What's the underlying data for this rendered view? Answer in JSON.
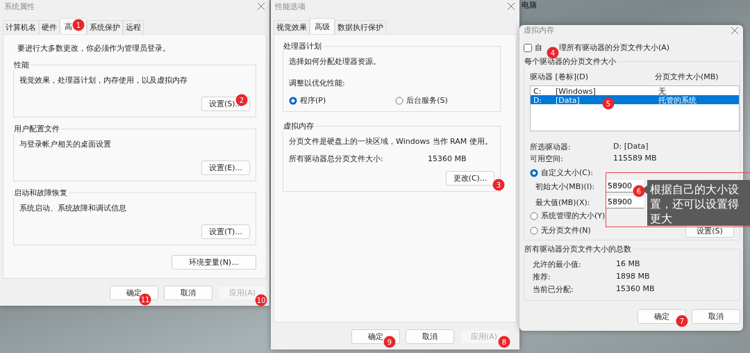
{
  "desktop": {
    "icon_label": "电脑"
  },
  "system_properties": {
    "title": "系统属性",
    "tabs": [
      {
        "label": "计算机名",
        "selected": false
      },
      {
        "label": "硬件",
        "selected": false
      },
      {
        "label": "高",
        "selected": true
      },
      {
        "label": "系统保护",
        "selected": false
      },
      {
        "label": "远程",
        "selected": false
      }
    ],
    "admin_note": "要进行大多数更改，你必须作为管理员登录。",
    "groups": [
      {
        "title": "性能",
        "description": "视觉效果，处理器计划，内存使用，以及虚拟内存",
        "button": "设置(S)..."
      },
      {
        "title": "用户配置文件",
        "description": "与登录帐户相关的桌面设置",
        "button": "设置(E)..."
      },
      {
        "title": "启动和故障恢复",
        "description": "系统启动、系统故障和调试信息",
        "button": "设置(T)..."
      }
    ],
    "env_button": "环境变量(N)...",
    "buttons": [
      {
        "label": "确定",
        "disabled": false
      },
      {
        "label": "取消",
        "disabled": false
      },
      {
        "label": "应用(A)",
        "disabled": true
      }
    ]
  },
  "performance_options": {
    "title": "性能选项",
    "tabs": [
      {
        "label": "视觉效果",
        "selected": false
      },
      {
        "label": "高级",
        "selected": true
      },
      {
        "label": "数据执行保护",
        "selected": false
      }
    ],
    "processor": {
      "title": "处理器计划",
      "description": "选择如何分配处理器资源。",
      "prompt": "调整以优化性能:",
      "options": [
        {
          "label": "程序(P)",
          "selected": true
        },
        {
          "label": "后台服务(S)",
          "selected": false
        }
      ]
    },
    "virtual_memory": {
      "title": "虚拟内存",
      "description": "分页文件是硬盘上的一块区域，Windows 当作 RAM 使用。",
      "total_label": "所有驱动器总分页文件大小:",
      "total_value": "15360 MB",
      "button": "更改(C)..."
    },
    "buttons": [
      {
        "label": "确定",
        "disabled": false
      },
      {
        "label": "取消",
        "disabled": false
      },
      {
        "label": "应用(A)",
        "disabled": true
      }
    ]
  },
  "virtual_memory": {
    "title": "虚拟内存",
    "auto_manage": {
      "label_start": "自",
      "label_end": "理所有驱动器的分页文件大小(A)",
      "checked": false
    },
    "per_drive": {
      "title": "每个驱动器的分页文件大小",
      "columns": [
        "驱动器 [卷标](D)",
        "分页文件大小(MB)"
      ],
      "drives": [
        {
          "drive": "C:",
          "volume": "[Windows]",
          "size": "无",
          "selected": false
        },
        {
          "drive": "D:",
          "volume": "[Data]",
          "size": "托管的系统",
          "selected": true
        }
      ],
      "selected_drive_label": "所选驱动器:",
      "selected_drive_value": "D:  [Data]",
      "free_space_label": "可用空间:",
      "free_space_value": "115589 MB",
      "options": [
        {
          "label": "自定义大小(C):",
          "selected": true
        },
        {
          "label": "系统管理的大小(Y)",
          "selected": false
        },
        {
          "label": "无分页文件(N)",
          "selected": false
        }
      ],
      "initial_label": "初始大小(MB)(I):",
      "initial_value": "58900",
      "max_label": "最大值(MB)(X):",
      "max_value": "58900",
      "set_button": "设置(S)"
    },
    "totals": {
      "title": "所有驱动器分页文件大小的总数",
      "rows": [
        {
          "label": "允许的最小值:",
          "value": "16 MB"
        },
        {
          "label": "推荐:",
          "value": "1898 MB"
        },
        {
          "label": "当前已分配:",
          "value": "15360 MB"
        }
      ]
    },
    "buttons": [
      {
        "label": "确定",
        "disabled": false
      },
      {
        "label": "取消",
        "disabled": false
      }
    ]
  },
  "annotations": [
    {
      "number": "1"
    },
    {
      "number": "2"
    },
    {
      "number": "3"
    },
    {
      "number": "4"
    },
    {
      "number": "5"
    },
    {
      "number": "6"
    },
    {
      "number": "7"
    },
    {
      "number": "8"
    },
    {
      "number": "9"
    },
    {
      "number": "10"
    },
    {
      "number": "11"
    }
  ],
  "callout": {
    "text": "根据自己的大小设置，还可以设置得更大"
  }
}
